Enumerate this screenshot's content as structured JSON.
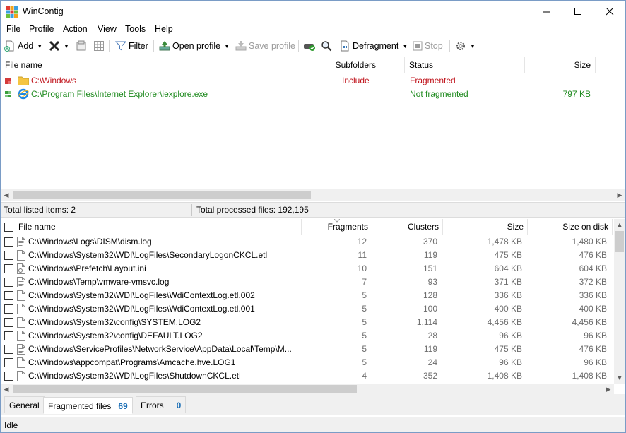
{
  "window": {
    "title": "WinContig"
  },
  "menu": [
    "File",
    "Profile",
    "Action",
    "View",
    "Tools",
    "Help"
  ],
  "toolbar": {
    "add": "Add",
    "filter": "Filter",
    "open_profile": "Open profile",
    "save_profile": "Save profile",
    "defragment": "Defragment",
    "stop": "Stop"
  },
  "top_list": {
    "columns": [
      "File name",
      "Subfolders",
      "Status",
      "Size"
    ],
    "rows": [
      {
        "name": "C:\\Windows",
        "subfolders": "Include",
        "status": "Fragmented",
        "size": ""
      },
      {
        "name": "C:\\Program Files\\Internet Explorer\\iexplore.exe",
        "subfolders": "",
        "status": "Not fragmented",
        "size": "797 KB"
      }
    ],
    "colors": {
      "fragmented": "#c0141c",
      "not_fragmented": "#1e8a1e"
    }
  },
  "info": {
    "listed": "Total listed items: 2",
    "processed": "Total processed files: 192,195"
  },
  "bottom_list": {
    "columns": [
      "File name",
      "Fragments",
      "Clusters",
      "Size",
      "Size on disk"
    ],
    "rows": [
      {
        "name": "C:\\Windows\\Logs\\DISM\\dism.log",
        "fragments": "12",
        "clusters": "370",
        "size": "1,478 KB",
        "disk": "1,480 KB"
      },
      {
        "name": "C:\\Windows\\System32\\WDI\\LogFiles\\SecondaryLogonCKCL.etl",
        "fragments": "11",
        "clusters": "119",
        "size": "475 KB",
        "disk": "476 KB"
      },
      {
        "name": "C:\\Windows\\Prefetch\\Layout.ini",
        "fragments": "10",
        "clusters": "151",
        "size": "604 KB",
        "disk": "604 KB"
      },
      {
        "name": "C:\\Windows\\Temp\\vmware-vmsvc.log",
        "fragments": "7",
        "clusters": "93",
        "size": "371 KB",
        "disk": "372 KB"
      },
      {
        "name": "C:\\Windows\\System32\\WDI\\LogFiles\\WdiContextLog.etl.002",
        "fragments": "5",
        "clusters": "128",
        "size": "336 KB",
        "disk": "336 KB"
      },
      {
        "name": "C:\\Windows\\System32\\WDI\\LogFiles\\WdiContextLog.etl.001",
        "fragments": "5",
        "clusters": "100",
        "size": "400 KB",
        "disk": "400 KB"
      },
      {
        "name": "C:\\Windows\\System32\\config\\SYSTEM.LOG2",
        "fragments": "5",
        "clusters": "1,114",
        "size": "4,456 KB",
        "disk": "4,456 KB"
      },
      {
        "name": "C:\\Windows\\System32\\config\\DEFAULT.LOG2",
        "fragments": "5",
        "clusters": "28",
        "size": "96 KB",
        "disk": "96 KB"
      },
      {
        "name": "C:\\Windows\\ServiceProfiles\\NetworkService\\AppData\\Local\\Temp\\M...",
        "fragments": "5",
        "clusters": "119",
        "size": "475 KB",
        "disk": "476 KB"
      },
      {
        "name": "C:\\Windows\\appcompat\\Programs\\Amcache.hve.LOG1",
        "fragments": "5",
        "clusters": "24",
        "size": "96 KB",
        "disk": "96 KB"
      },
      {
        "name": "C:\\Windows\\System32\\WDI\\LogFiles\\ShutdownCKCL.etl",
        "fragments": "4",
        "clusters": "352",
        "size": "1,408 KB",
        "disk": "1,408 KB"
      }
    ]
  },
  "tabs": [
    {
      "label": "General",
      "count": ""
    },
    {
      "label": "Fragmented files",
      "count": "69"
    },
    {
      "label": "Errors",
      "count": "0"
    }
  ],
  "status": "Idle"
}
